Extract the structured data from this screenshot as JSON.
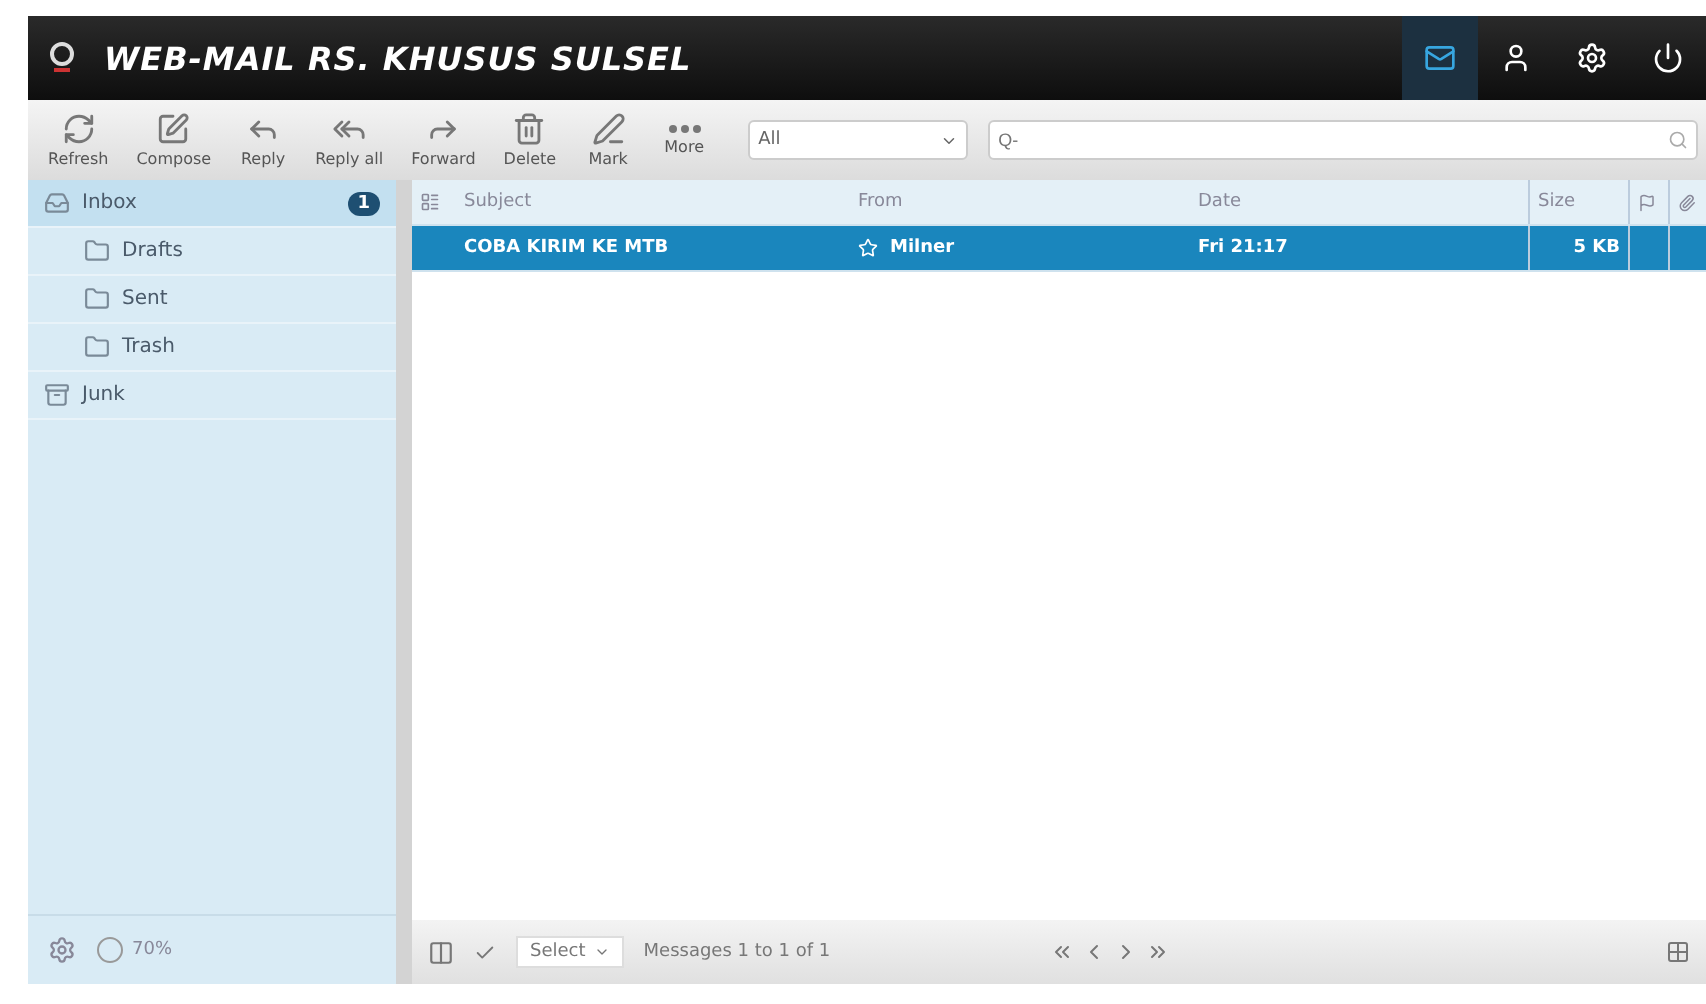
{
  "header": {
    "title": "WEB-MAIL RS. KHUSUS SULSEL",
    "nav": [
      {
        "kind": "mail",
        "selected": true
      },
      {
        "kind": "contacts",
        "selected": false
      },
      {
        "kind": "settings",
        "selected": false
      },
      {
        "kind": "logout",
        "selected": false
      }
    ]
  },
  "toolbar": {
    "buttons": [
      {
        "kind": "refresh",
        "label": "Refresh",
        "disabled": false
      },
      {
        "kind": "compose",
        "label": "Compose",
        "disabled": false
      },
      {
        "kind": "reply",
        "label": "Reply",
        "disabled": false
      },
      {
        "kind": "replyall",
        "label": "Reply all",
        "disabled": false
      },
      {
        "kind": "forward",
        "label": "Forward",
        "disabled": false
      },
      {
        "kind": "delete",
        "label": "Delete",
        "disabled": false
      },
      {
        "kind": "mark",
        "label": "Mark",
        "disabled": false
      },
      {
        "kind": "more",
        "label": "More",
        "disabled": false
      }
    ],
    "filter": "All",
    "search": {
      "placeholder": "Q-"
    }
  },
  "folders": [
    {
      "name": "Inbox",
      "kind": "inbox",
      "selected": true,
      "count": "1",
      "children": [
        {
          "name": "Drafts",
          "kind": "folder",
          "selected": false
        },
        {
          "name": "Sent",
          "kind": "folder",
          "selected": false
        },
        {
          "name": "Trash",
          "kind": "folder",
          "selected": false
        }
      ]
    },
    {
      "name": "Junk",
      "kind": "junk",
      "selected": false
    }
  ],
  "quota": "70%",
  "table": {
    "columns": [
      "Subject",
      "From",
      "Date",
      "Size"
    ],
    "rows": [
      {
        "subject": "COBA KIRIM KE MTB",
        "from": "Milner",
        "date": "Fri 21:17",
        "size": "5 KB",
        "selected": true
      }
    ]
  },
  "footer": {
    "select": "Select",
    "count": "Messages 1 to 1 of 1"
  }
}
